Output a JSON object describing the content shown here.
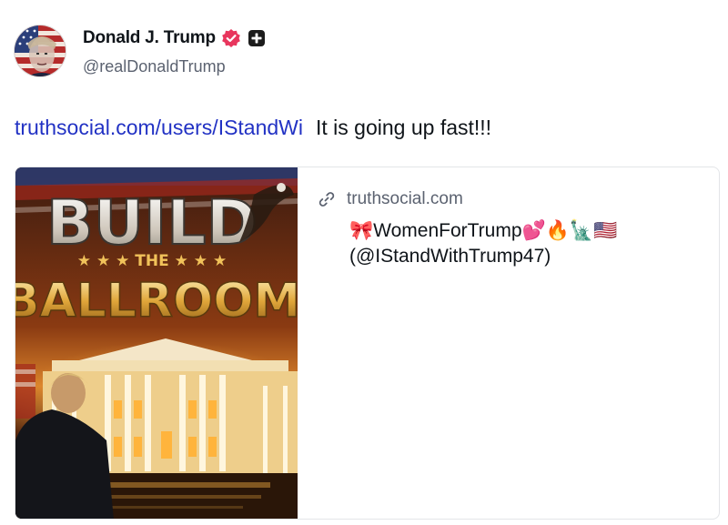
{
  "author": {
    "display_name": "Donald J. Trump",
    "handle": "@realDonaldTrump",
    "avatar_icon": "avatar-flag-portrait",
    "verified_icon": "verified-badge-icon",
    "verified_color": "#e8365d",
    "plus_icon": "plus-badge-icon"
  },
  "post": {
    "link_text": "truthsocial.com/users/IStandWi",
    "text": "It is going up fast!!!",
    "link_color": "#2232c4"
  },
  "card": {
    "link_icon": "link-icon",
    "domain": "truthsocial.com",
    "title": "🎀WomenForTrump💕🔥🗽🇺🇸",
    "subtitle": "(@IStandWithTrump47)",
    "image": {
      "line1": "BUILD",
      "line2": "★ ★ ★ THE ★ ★ ★",
      "line3": "BALLROOM"
    }
  }
}
